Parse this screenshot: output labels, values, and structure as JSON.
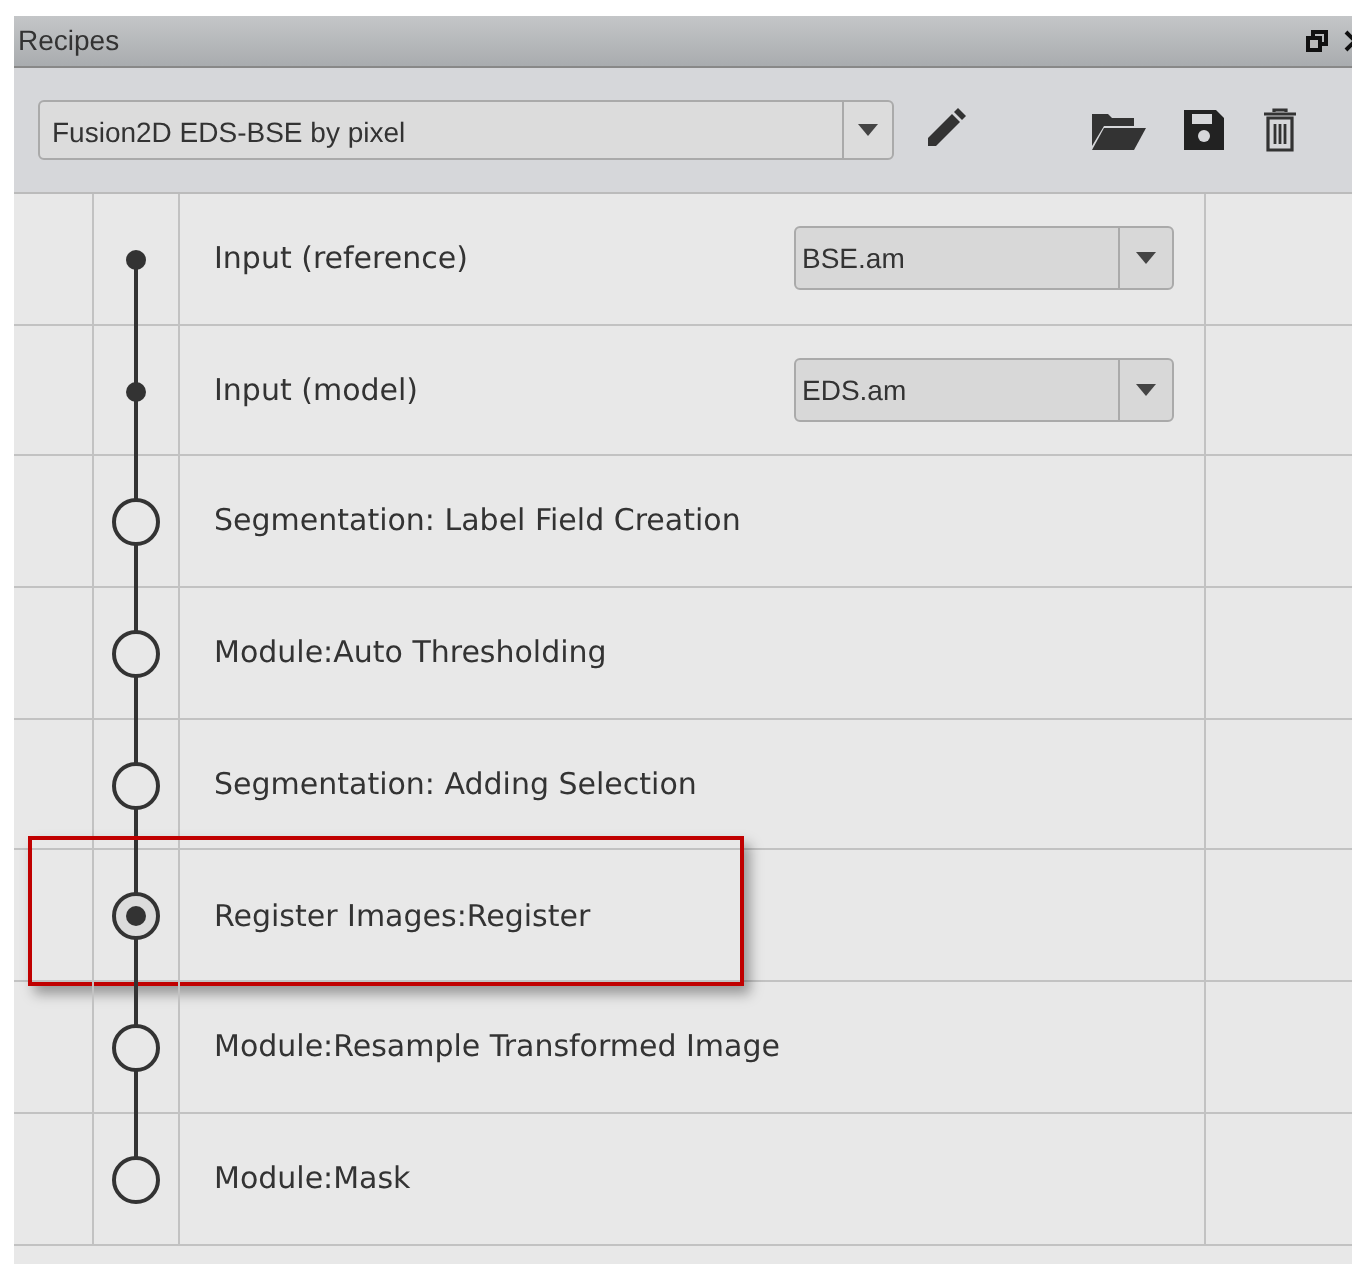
{
  "panel": {
    "title": "Recipes"
  },
  "toolbar": {
    "recipe": "Fusion2D EDS-BSE by pixel"
  },
  "steps": [
    {
      "kind": "input",
      "label": "Input (reference)",
      "value": "BSE.am",
      "selected": false,
      "highlighted": false
    },
    {
      "kind": "input",
      "label": "Input (model)",
      "value": "EDS.am",
      "selected": false,
      "highlighted": false
    },
    {
      "kind": "module",
      "label": "Segmentation: Label Field Creation",
      "selected": false,
      "highlighted": false
    },
    {
      "kind": "module",
      "label": "Module:Auto Thresholding",
      "selected": false,
      "highlighted": false
    },
    {
      "kind": "module",
      "label": "Segmentation: Adding Selection",
      "selected": false,
      "highlighted": false
    },
    {
      "kind": "module",
      "label": "Register Images:Register",
      "selected": true,
      "highlighted": true
    },
    {
      "kind": "module",
      "label": "Module:Resample Transformed Image",
      "selected": false,
      "highlighted": false
    },
    {
      "kind": "module",
      "label": "Module:Mask",
      "selected": false,
      "highlighted": false
    }
  ]
}
